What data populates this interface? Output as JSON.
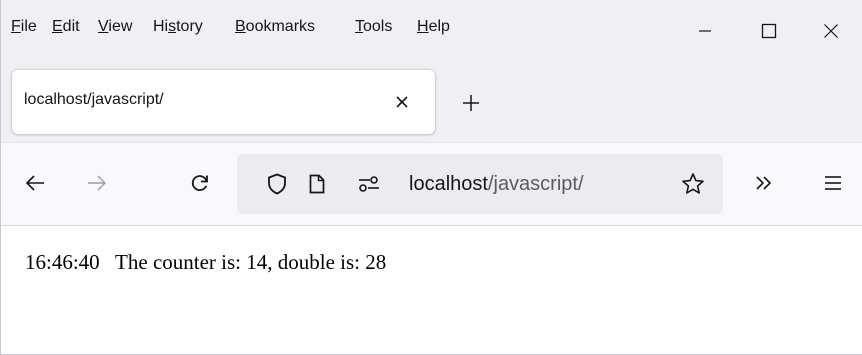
{
  "menubar": {
    "items": [
      {
        "pre": "",
        "ul": "F",
        "post": "ile"
      },
      {
        "pre": "",
        "ul": "E",
        "post": "dit"
      },
      {
        "pre": "",
        "ul": "V",
        "post": "iew"
      },
      {
        "pre": "Hi",
        "ul": "s",
        "post": "tory"
      },
      {
        "pre": "",
        "ul": "B",
        "post": "ookmarks"
      },
      {
        "pre": "",
        "ul": "T",
        "post": "ools"
      },
      {
        "pre": "",
        "ul": "H",
        "post": "elp"
      }
    ]
  },
  "window_controls": {
    "minimize_icon": "minimize-icon",
    "maximize_icon": "maximize-icon",
    "close_icon": "close-icon"
  },
  "tab": {
    "title": "localhost/javascript/"
  },
  "navbar": {
    "url_host": "localhost",
    "url_path": "/javascript/"
  },
  "page": {
    "time": "16:46:40",
    "message": "The counter is: 14, double is: 28"
  },
  "colors": {
    "chrome_bg": "#f0f0f4",
    "toolbar_bg": "#f9f9fb",
    "urlbar_bg": "#ecebf0",
    "text": "#15141a",
    "muted_text": "#5b5b66"
  }
}
